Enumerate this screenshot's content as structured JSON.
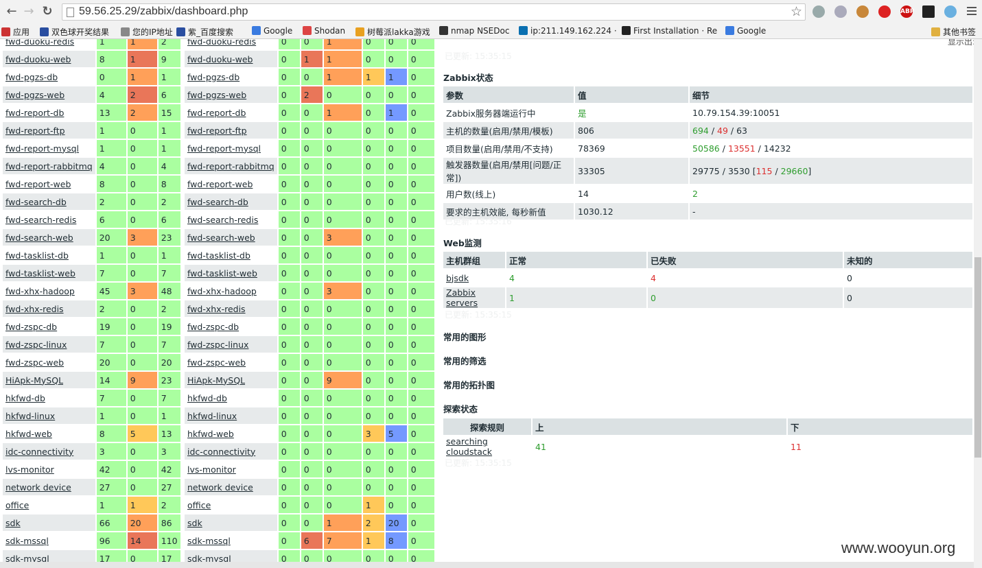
{
  "browser": {
    "url": "59.56.25.29/zabbix/dashboard.php",
    "back": "←",
    "forward": "→",
    "reload": "↻",
    "star": "☆",
    "bookmarks": [
      {
        "label": "应用",
        "color": "#c33"
      },
      {
        "label": "双色球开奖结果",
        "color": "#2a4ea0"
      },
      {
        "label": "您的IP地址",
        "color": "#888"
      },
      {
        "label": "紫_百度搜索",
        "color": "#2a4ea0"
      },
      {
        "label": "Google",
        "color": "#3a7be0"
      },
      {
        "label": "Shodan",
        "color": "#d44"
      },
      {
        "label": "树莓派lakka游戏",
        "color": "#e8a020"
      },
      {
        "label": "nmap NSEDoc",
        "color": "#333"
      },
      {
        "label": "ip:211.149.162.224 ·",
        "color": "#0a6fb0"
      },
      {
        "label": "First Installation · Re",
        "color": "#222"
      },
      {
        "label": "Google",
        "color": "#3a7be0"
      },
      {
        "label": "其他书签",
        "color": "#e0b040"
      }
    ]
  },
  "left_grid": {
    "rows": [
      [
        "fwd-duoku-redis",
        "1",
        "1",
        "2"
      ],
      [
        "fwd-duoku-web",
        "8",
        "1",
        "9"
      ],
      [
        "fwd-pgzs-db",
        "0",
        "1",
        "1"
      ],
      [
        "fwd-pgzs-web",
        "4",
        "2",
        "6"
      ],
      [
        "fwd-report-db",
        "13",
        "2",
        "15"
      ],
      [
        "fwd-report-ftp",
        "1",
        "0",
        "1"
      ],
      [
        "fwd-report-mysql",
        "1",
        "0",
        "1"
      ],
      [
        "fwd-report-rabbitmq",
        "4",
        "0",
        "4"
      ],
      [
        "fwd-report-web",
        "8",
        "0",
        "8"
      ],
      [
        "fwd-search-db",
        "2",
        "0",
        "2"
      ],
      [
        "fwd-search-redis",
        "6",
        "0",
        "6"
      ],
      [
        "fwd-search-web",
        "20",
        "3",
        "23"
      ],
      [
        "fwd-tasklist-db",
        "1",
        "0",
        "1"
      ],
      [
        "fwd-tasklist-web",
        "7",
        "0",
        "7"
      ],
      [
        "fwd-xhx-hadoop",
        "45",
        "3",
        "48"
      ],
      [
        "fwd-xhx-redis",
        "2",
        "0",
        "2"
      ],
      [
        "fwd-zspc-db",
        "19",
        "0",
        "19"
      ],
      [
        "fwd-zspc-linux",
        "7",
        "0",
        "7"
      ],
      [
        "fwd-zspc-web",
        "20",
        "0",
        "20"
      ],
      [
        "HiApk-MySQL",
        "14",
        "9",
        "23"
      ],
      [
        "hkfwd-db",
        "7",
        "0",
        "7"
      ],
      [
        "hkfwd-linux",
        "1",
        "0",
        "1"
      ],
      [
        "hkfwd-web",
        "8",
        "5",
        "13"
      ],
      [
        "idc-connectivity",
        "3",
        "0",
        "3"
      ],
      [
        "lvs-monitor",
        "42",
        "0",
        "42"
      ],
      [
        "network device",
        "27",
        "0",
        "27"
      ],
      [
        "office",
        "1",
        "1",
        "2"
      ],
      [
        "sdk",
        "66",
        "20",
        "86"
      ],
      [
        "sdk-mssql",
        "96",
        "14",
        "110"
      ],
      [
        "sdk-mysql",
        "17",
        "0",
        "17"
      ]
    ],
    "colors": [
      [
        "g",
        "o",
        "g"
      ],
      [
        "g",
        "r",
        "g"
      ],
      [
        "g",
        "o",
        "g"
      ],
      [
        "g",
        "r",
        "g"
      ],
      [
        "g",
        "o",
        "g"
      ],
      [
        "g",
        "g",
        "g"
      ],
      [
        "g",
        "g",
        "g"
      ],
      [
        "g",
        "g",
        "g"
      ],
      [
        "g",
        "g",
        "g"
      ],
      [
        "g",
        "g",
        "g"
      ],
      [
        "g",
        "g",
        "g"
      ],
      [
        "g",
        "o",
        "g"
      ],
      [
        "g",
        "g",
        "g"
      ],
      [
        "g",
        "g",
        "g"
      ],
      [
        "g",
        "o",
        "g"
      ],
      [
        "g",
        "g",
        "g"
      ],
      [
        "g",
        "g",
        "g"
      ],
      [
        "g",
        "g",
        "g"
      ],
      [
        "g",
        "g",
        "g"
      ],
      [
        "g",
        "o",
        "g"
      ],
      [
        "g",
        "g",
        "g"
      ],
      [
        "g",
        "g",
        "g"
      ],
      [
        "g",
        "y",
        "g"
      ],
      [
        "g",
        "g",
        "g"
      ],
      [
        "g",
        "g",
        "g"
      ],
      [
        "g",
        "g",
        "g"
      ],
      [
        "g",
        "y",
        "g"
      ],
      [
        "g",
        "o",
        "g"
      ],
      [
        "g",
        "r",
        "g"
      ],
      [
        "g",
        "g",
        "g"
      ]
    ]
  },
  "mid_grid": {
    "rows": [
      [
        "fwd-duoku-redis",
        "0",
        "0",
        "1",
        "0",
        "0",
        "0"
      ],
      [
        "fwd-duoku-web",
        "0",
        "1",
        "1",
        "0",
        "0",
        "0"
      ],
      [
        "fwd-pgzs-db",
        "0",
        "0",
        "1",
        "1",
        "1",
        "0"
      ],
      [
        "fwd-pgzs-web",
        "0",
        "2",
        "0",
        "0",
        "0",
        "0"
      ],
      [
        "fwd-report-db",
        "0",
        "0",
        "1",
        "0",
        "1",
        "0"
      ],
      [
        "fwd-report-ftp",
        "0",
        "0",
        "0",
        "0",
        "0",
        "0"
      ],
      [
        "fwd-report-mysql",
        "0",
        "0",
        "0",
        "0",
        "0",
        "0"
      ],
      [
        "fwd-report-rabbitmq",
        "0",
        "0",
        "0",
        "0",
        "0",
        "0"
      ],
      [
        "fwd-report-web",
        "0",
        "0",
        "0",
        "0",
        "0",
        "0"
      ],
      [
        "fwd-search-db",
        "0",
        "0",
        "0",
        "0",
        "0",
        "0"
      ],
      [
        "fwd-search-redis",
        "0",
        "0",
        "0",
        "0",
        "0",
        "0"
      ],
      [
        "fwd-search-web",
        "0",
        "0",
        "3",
        "0",
        "0",
        "0"
      ],
      [
        "fwd-tasklist-db",
        "0",
        "0",
        "0",
        "0",
        "0",
        "0"
      ],
      [
        "fwd-tasklist-web",
        "0",
        "0",
        "0",
        "0",
        "0",
        "0"
      ],
      [
        "fwd-xhx-hadoop",
        "0",
        "0",
        "3",
        "0",
        "0",
        "0"
      ],
      [
        "fwd-xhx-redis",
        "0",
        "0",
        "0",
        "0",
        "0",
        "0"
      ],
      [
        "fwd-zspc-db",
        "0",
        "0",
        "0",
        "0",
        "0",
        "0"
      ],
      [
        "fwd-zspc-linux",
        "0",
        "0",
        "0",
        "0",
        "0",
        "0"
      ],
      [
        "fwd-zspc-web",
        "0",
        "0",
        "0",
        "0",
        "0",
        "0"
      ],
      [
        "HiApk-MySQL",
        "0",
        "0",
        "9",
        "0",
        "0",
        "0"
      ],
      [
        "hkfwd-db",
        "0",
        "0",
        "0",
        "0",
        "0",
        "0"
      ],
      [
        "hkfwd-linux",
        "0",
        "0",
        "0",
        "0",
        "0",
        "0"
      ],
      [
        "hkfwd-web",
        "0",
        "0",
        "0",
        "3",
        "5",
        "0"
      ],
      [
        "idc-connectivity",
        "0",
        "0",
        "0",
        "0",
        "0",
        "0"
      ],
      [
        "lvs-monitor",
        "0",
        "0",
        "0",
        "0",
        "0",
        "0"
      ],
      [
        "network device",
        "0",
        "0",
        "0",
        "0",
        "0",
        "0"
      ],
      [
        "office",
        "0",
        "0",
        "0",
        "1",
        "0",
        "0"
      ],
      [
        "sdk",
        "0",
        "0",
        "1",
        "2",
        "20",
        "0"
      ],
      [
        "sdk-mssql",
        "0",
        "6",
        "7",
        "1",
        "8",
        "0"
      ],
      [
        "sdk-mysql",
        "0",
        "0",
        "0",
        "0",
        "0",
        "0"
      ]
    ],
    "colors": [
      [
        "g",
        "g",
        "o",
        "g",
        "g",
        "g"
      ],
      [
        "g",
        "r",
        "o",
        "g",
        "g",
        "g"
      ],
      [
        "g",
        "g",
        "o",
        "y",
        "b",
        "g"
      ],
      [
        "g",
        "r",
        "g",
        "g",
        "g",
        "g"
      ],
      [
        "g",
        "g",
        "o",
        "g",
        "b",
        "g"
      ],
      [
        "g",
        "g",
        "g",
        "g",
        "g",
        "g"
      ],
      [
        "g",
        "g",
        "g",
        "g",
        "g",
        "g"
      ],
      [
        "g",
        "g",
        "g",
        "g",
        "g",
        "g"
      ],
      [
        "g",
        "g",
        "g",
        "g",
        "g",
        "g"
      ],
      [
        "g",
        "g",
        "g",
        "g",
        "g",
        "g"
      ],
      [
        "g",
        "g",
        "g",
        "g",
        "g",
        "g"
      ],
      [
        "g",
        "g",
        "o",
        "g",
        "g",
        "g"
      ],
      [
        "g",
        "g",
        "g",
        "g",
        "g",
        "g"
      ],
      [
        "g",
        "g",
        "g",
        "g",
        "g",
        "g"
      ],
      [
        "g",
        "g",
        "o",
        "g",
        "g",
        "g"
      ],
      [
        "g",
        "g",
        "g",
        "g",
        "g",
        "g"
      ],
      [
        "g",
        "g",
        "g",
        "g",
        "g",
        "g"
      ],
      [
        "g",
        "g",
        "g",
        "g",
        "g",
        "g"
      ],
      [
        "g",
        "g",
        "g",
        "g",
        "g",
        "g"
      ],
      [
        "g",
        "g",
        "o",
        "g",
        "g",
        "g"
      ],
      [
        "g",
        "g",
        "g",
        "g",
        "g",
        "g"
      ],
      [
        "g",
        "g",
        "g",
        "g",
        "g",
        "g"
      ],
      [
        "g",
        "g",
        "g",
        "y",
        "b",
        "g"
      ],
      [
        "g",
        "g",
        "g",
        "g",
        "g",
        "g"
      ],
      [
        "g",
        "g",
        "g",
        "g",
        "g",
        "g"
      ],
      [
        "g",
        "g",
        "g",
        "g",
        "g",
        "g"
      ],
      [
        "g",
        "g",
        "g",
        "y",
        "g",
        "g"
      ],
      [
        "g",
        "g",
        "o",
        "y",
        "b",
        "g"
      ],
      [
        "g",
        "r",
        "o",
        "y",
        "b",
        "g"
      ],
      [
        "g",
        "g",
        "g",
        "g",
        "g",
        "g"
      ]
    ]
  },
  "right": {
    "top_note": "显示出:",
    "updated_1": "已更新: 15:35:15",
    "zabbix_status": {
      "title": "Zabbix状态",
      "headers": [
        "参数",
        "值",
        "细节"
      ],
      "rows": [
        {
          "param": "Zabbix服务器端运行中",
          "value": "是",
          "detail": "10.79.154.39:10051"
        },
        {
          "param": "主机的数量(启用/禁用/模板)",
          "value": "806",
          "d1": "694",
          "d2": "49",
          "d3": "63"
        },
        {
          "param": "项目数量(启用/禁用/不支持)",
          "value": "78369",
          "d1": "50586",
          "d2": "13551",
          "d3": "14232"
        },
        {
          "param": "触发器数量(启用/禁用[问题/正常])",
          "value": "33305",
          "d1": "29775",
          "d2": "3530",
          "d3": "115",
          "d4": "29660"
        },
        {
          "param": "用户数(线上)",
          "value": "14",
          "detail": "2"
        },
        {
          "param": "要求的主机效能, 每秒新值",
          "value": "1030.12",
          "detail": "-"
        }
      ],
      "updated": "已更新: 15:35:16"
    },
    "web_monitor": {
      "title": "Web监测",
      "headers": [
        "主机群组",
        "正常",
        "已失败",
        "未知的"
      ],
      "rows": [
        {
          "group": "bjsdk",
          "ok": "4",
          "failed": "4",
          "unknown": "0"
        },
        {
          "group": "Zabbix servers",
          "ok": "1",
          "failed": "0",
          "unknown": "0"
        }
      ],
      "updated": "已更新: 15:35:15"
    },
    "fav_graphs": "常用的图形",
    "fav_filters": "常用的筛选",
    "fav_maps": "常用的拓扑图",
    "discovery": {
      "title": "探索状态",
      "headers": [
        "探索规则",
        "上",
        "下"
      ],
      "rows": [
        {
          "rule": "searching cloudstack",
          "up": "41",
          "down": "11"
        }
      ],
      "updated": "已更新: 15:35:15"
    }
  },
  "watermark": "www.wooyun.org"
}
